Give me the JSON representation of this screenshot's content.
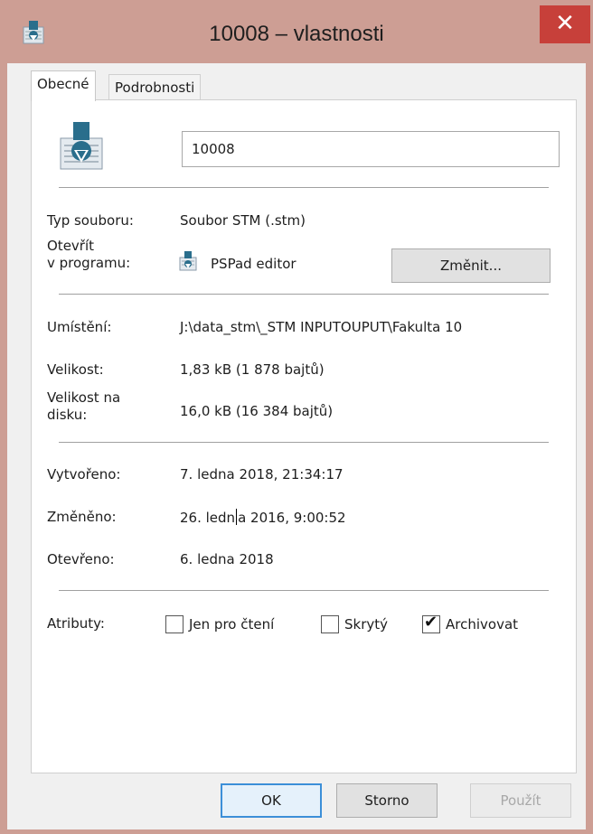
{
  "window": {
    "title": "10008 – vlastnosti",
    "close_symbol": "✕",
    "icon": "file-icon"
  },
  "tabs": [
    {
      "label": "Obecné",
      "active": true
    },
    {
      "label": "Podrobnosti",
      "active": false
    }
  ],
  "general": {
    "file_name": "10008",
    "file_type_label": "Typ souboru:",
    "file_type_value": "Soubor STM (.stm)",
    "opens_with_label_line1": "Otevřít",
    "opens_with_label_line2": "v programu:",
    "opens_with_value": "PSPad editor",
    "change_button": "Změnit...",
    "location_label": "Umístění:",
    "location_value": "J:\\data_stm\\_STM INPUTOUPUT\\Fakulta 10",
    "size_label": "Velikost:",
    "size_value": "1,83 kB (1 878 bajtů)",
    "size_on_disk_label_line1": "Velikost na",
    "size_on_disk_label_line2": "disku:",
    "size_on_disk_value": "16,0 kB (16 384 bajtů)",
    "created_label": "Vytvořeno:",
    "created_value": "7. ledna 2018, 21:34:17",
    "modified_label": "Změněno:",
    "modified_value_part1": "26. ledn",
    "modified_value_part2": "a 2016, 9:00:52",
    "accessed_label": "Otevřeno:",
    "accessed_value": "6. ledna 2018",
    "attributes_label": "Atributy:",
    "attributes": [
      {
        "label": "Jen pro čtení",
        "checked": false
      },
      {
        "label": "Skrytý",
        "checked": false
      },
      {
        "label": "Archivovat",
        "checked": true
      }
    ]
  },
  "footer": {
    "ok": "OK",
    "cancel": "Storno",
    "apply": "Použít"
  },
  "colors": {
    "frame": "#cd9e94",
    "close": "#c7403a",
    "panel": "#ffffff",
    "client": "#f0f0f0"
  }
}
